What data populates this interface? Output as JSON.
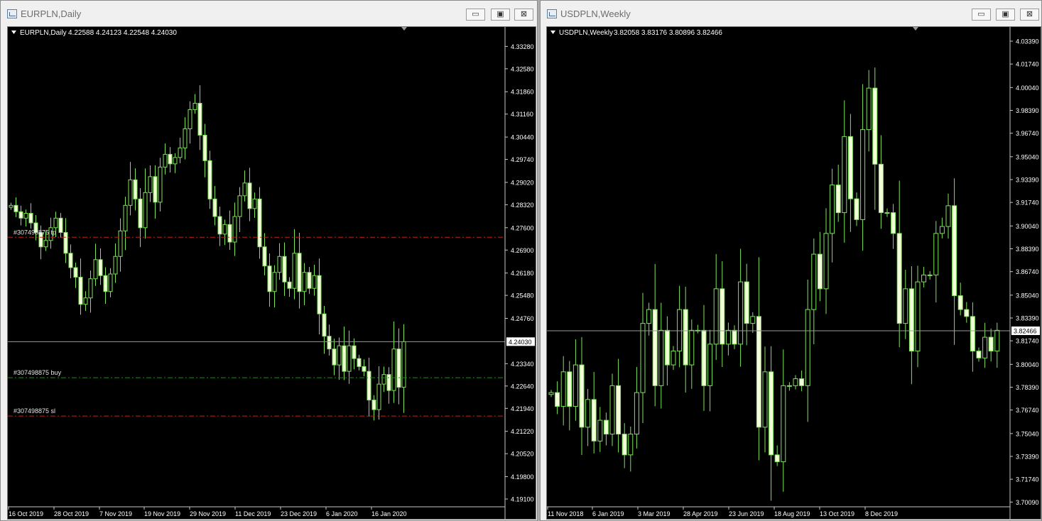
{
  "windows": [
    {
      "id": "eurpln",
      "title": "EURPLN,Daily",
      "header": {
        "symbol": "EURPLN,Daily",
        "ohlc": "4.22588 4.24123 4.22548 4.24030"
      },
      "buttons": {
        "minimize": "▭",
        "restore": "▣",
        "close": "⊠"
      },
      "chart_data": {
        "type": "candlestick",
        "x_labels": [
          "16 Oct 2019",
          "28 Oct 2019",
          "7 Nov 2019",
          "19 Nov 2019",
          "29 Nov 2019",
          "11 Dec 2019",
          "23 Dec 2019",
          "6 Jan 2020",
          "16 Jan 2020"
        ],
        "y_ticks": [
          "4.33280",
          "4.32580",
          "4.31860",
          "4.31160",
          "4.30440",
          "4.29740",
          "4.29020",
          "4.28320",
          "4.27600",
          "4.26900",
          "4.26180",
          "4.25480",
          "4.24760",
          "4.23340",
          "4.22640",
          "4.21940",
          "4.21220",
          "4.20520",
          "4.19800",
          "4.19100"
        ],
        "ylim": [
          4.189,
          4.336
        ],
        "current_price": "4.24030",
        "levels": [
          {
            "label": "#307498875 tp",
            "value": 4.273,
            "color": "#c02020"
          },
          {
            "label": "#307498875 buy",
            "value": 4.229,
            "color": "#1c8c1c"
          },
          {
            "label": "#307498875 sl",
            "value": 4.217,
            "color": "#c02020"
          }
        ],
        "closes": [
          4.283,
          4.281,
          4.279,
          4.2805,
          4.2775,
          4.2745,
          4.27,
          4.272,
          4.276,
          4.279,
          4.2745,
          4.268,
          4.2635,
          4.2605,
          4.252,
          4.254,
          4.26,
          4.266,
          4.261,
          4.256,
          4.2615,
          4.267,
          4.275,
          4.283,
          4.291,
          4.285,
          4.276,
          4.287,
          4.292,
          4.284,
          4.295,
          4.299,
          4.296,
          4.298,
          4.301,
          4.307,
          4.313,
          4.315,
          4.305,
          4.297,
          4.285,
          4.2795,
          4.274,
          4.277,
          4.2715,
          4.2795,
          4.286,
          4.29,
          4.282,
          4.285,
          4.27,
          4.264,
          4.256,
          4.262,
          4.267,
          4.259,
          4.257,
          4.268,
          4.256,
          4.262,
          4.257,
          4.261,
          4.249,
          4.242,
          4.238,
          4.233,
          4.239,
          4.231,
          4.239,
          4.235,
          4.2325,
          4.231,
          4.222,
          4.219,
          4.227,
          4.23,
          4.225,
          4.238,
          4.226,
          4.2403
        ]
      }
    },
    {
      "id": "usdpln",
      "title": "USDPLN,Weekly",
      "header": {
        "symbol": "USDPLN,Weekly",
        "ohlc": "3.82058 3.83176 3.80896 3.82466"
      },
      "buttons": {
        "minimize": "▭",
        "restore": "▣",
        "close": "⊠"
      },
      "chart_data": {
        "type": "candlestick",
        "x_labels": [
          "11 Nov 2018",
          "6 Jan 2019",
          "3 Mar 2019",
          "28 Apr 2019",
          "23 Jun 2019",
          "18 Aug 2019",
          "13 Oct 2019",
          "8 Dec 2019"
        ],
        "y_ticks": [
          "4.03390",
          "4.01740",
          "4.00040",
          "3.98390",
          "3.96740",
          "3.95040",
          "3.93390",
          "3.91740",
          "3.90040",
          "3.88390",
          "3.86740",
          "3.85040",
          "3.83390",
          "3.81740",
          "3.80040",
          "3.78390",
          "3.76740",
          "3.75040",
          "3.73390",
          "3.71740",
          "3.70090"
        ],
        "ylim": [
          3.6985,
          4.0375
        ],
        "current_price": "3.82466",
        "closes": [
          3.78,
          3.77,
          3.795,
          3.77,
          3.8,
          3.755,
          3.775,
          3.745,
          3.76,
          3.75,
          3.785,
          3.75,
          3.735,
          3.75,
          3.78,
          3.83,
          3.84,
          3.785,
          3.825,
          3.8,
          3.81,
          3.84,
          3.8,
          3.825,
          3.825,
          3.785,
          3.815,
          3.855,
          3.815,
          3.825,
          3.815,
          3.86,
          3.83,
          3.835,
          3.755,
          3.795,
          3.735,
          3.73,
          3.785,
          3.785,
          3.79,
          3.785,
          3.84,
          3.88,
          3.855,
          3.895,
          3.93,
          3.91,
          3.965,
          3.92,
          3.905,
          3.97,
          4.0,
          3.945,
          3.91,
          3.91,
          3.895,
          3.83,
          3.855,
          3.81,
          3.86,
          3.865,
          3.865,
          3.895,
          3.9,
          3.915,
          3.85,
          3.84,
          3.835,
          3.81,
          3.805,
          3.82,
          3.81,
          3.825
        ]
      }
    }
  ]
}
